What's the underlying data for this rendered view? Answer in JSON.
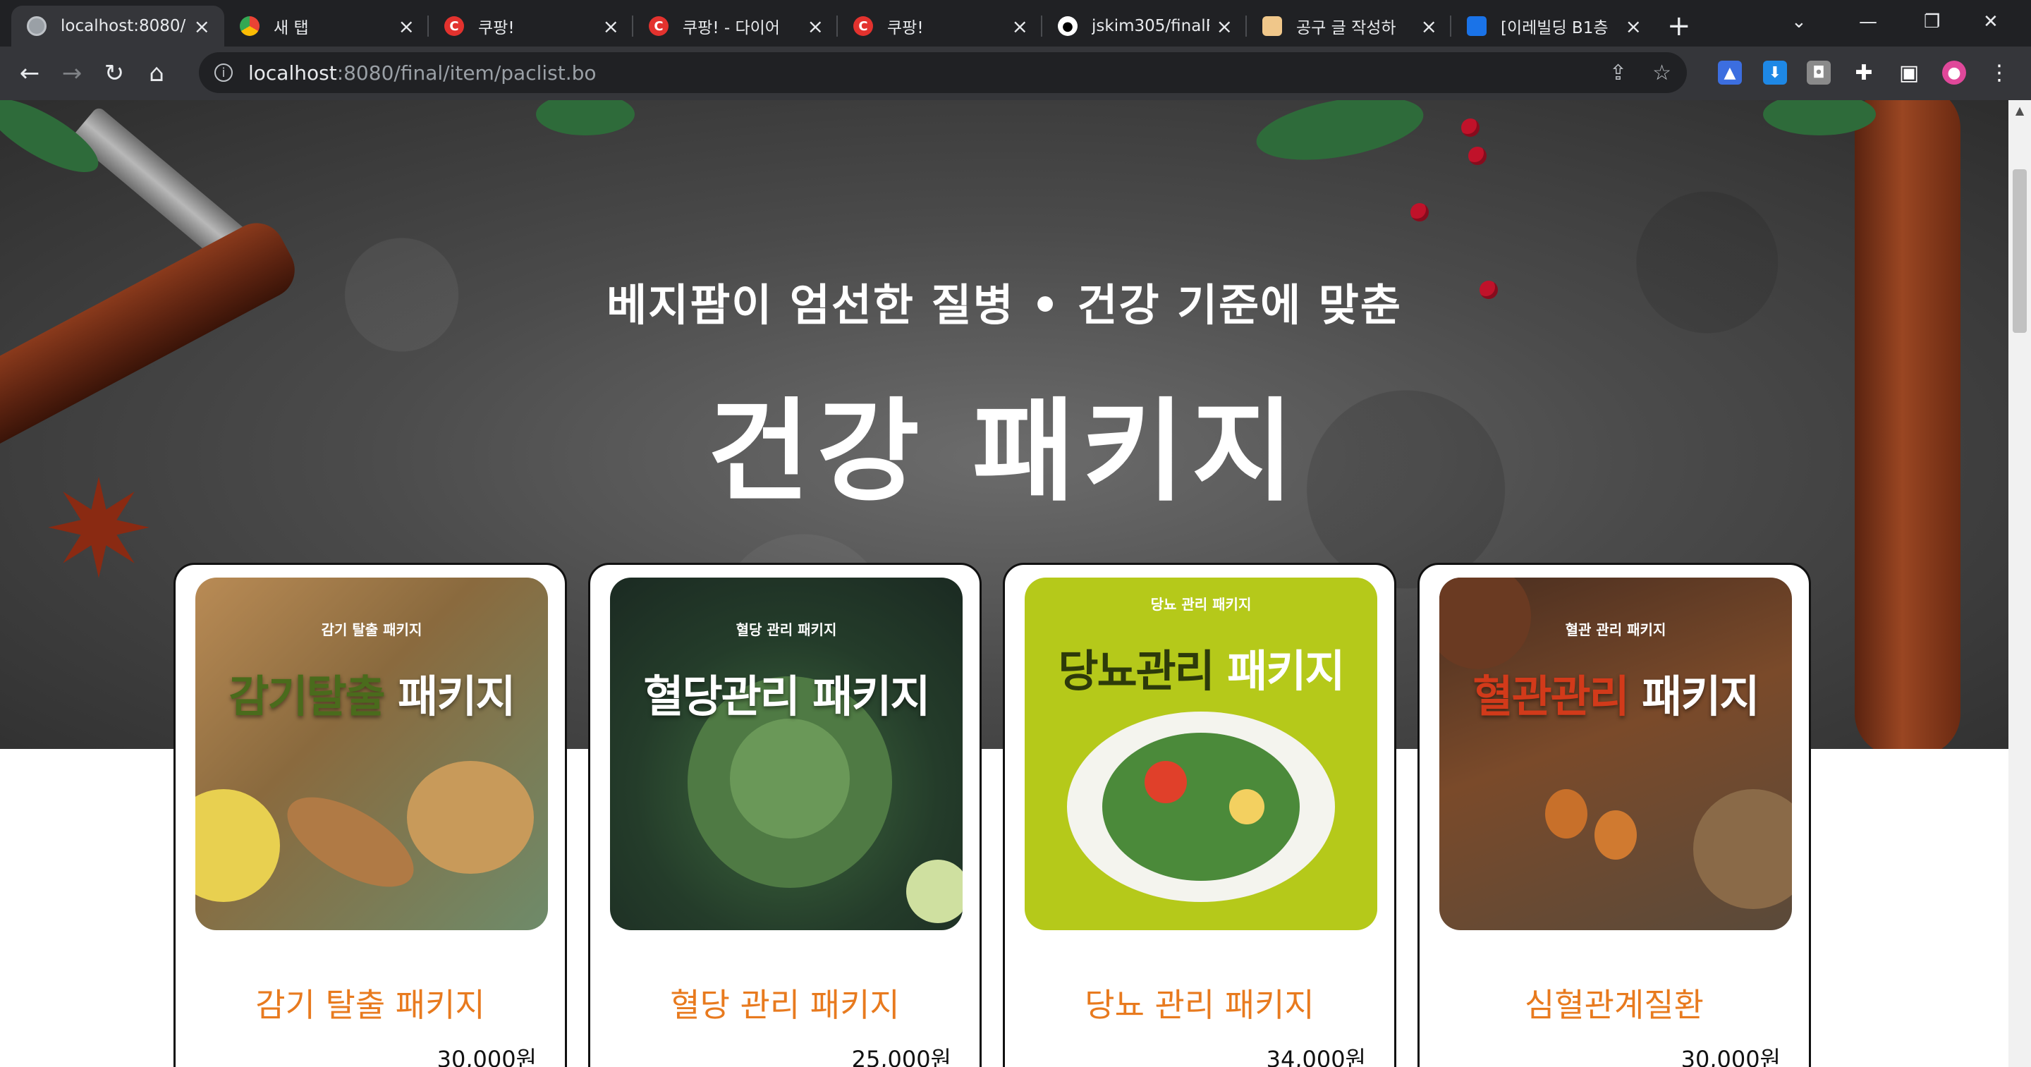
{
  "browser": {
    "tabs": [
      {
        "title": "localhost:8080/",
        "favicon": "globe-icon",
        "active": true
      },
      {
        "title": "새 탭",
        "favicon": "chrome-icon",
        "active": false
      },
      {
        "title": "쿠팡!",
        "favicon": "coupang-icon",
        "active": false
      },
      {
        "title": "쿠팡! - 다이어",
        "favicon": "coupang-icon",
        "active": false
      },
      {
        "title": "쿠팡!",
        "favicon": "coupang-icon",
        "active": false
      },
      {
        "title": "jskim305/finalP",
        "favicon": "github-icon",
        "active": false
      },
      {
        "title": "공구 글 작성하",
        "favicon": "folder-icon",
        "active": false
      },
      {
        "title": "[이레빌딩 B1층",
        "favicon": "blue-app-icon",
        "active": false
      }
    ],
    "new_tab_symbol": "+",
    "url_host": "localhost",
    "url_path": ":8080/final/item/paclist.bo"
  },
  "hero": {
    "subtitle": "베지팜이 엄선한 질병 • 건강 기준에 맞춘",
    "title": "건강 패키지"
  },
  "products": [
    {
      "thumb_small": "감기 탈출 패키지",
      "thumb_big_accent": "감기탈출",
      "thumb_big_rest": " 패키지",
      "name": "감기 탈출 패키지",
      "price": "30,000원",
      "accent_color": "#4a6b1c"
    },
    {
      "thumb_small": "혈당 관리 패키지",
      "thumb_big_accent": "혈당관리",
      "thumb_big_rest": " 패키지",
      "name": "혈당 관리 패키지",
      "price": "25,000원",
      "accent_color": "#ffffff"
    },
    {
      "thumb_small": "당뇨 관리 패키지",
      "thumb_big_accent": "당뇨관리",
      "thumb_big_rest": " 패키지",
      "name": "당뇨 관리 패키지",
      "price": "34,000원",
      "accent_color": "#2d3a0a"
    },
    {
      "thumb_small": "혈관 관리 패키지",
      "thumb_big_accent": "혈관관리",
      "thumb_big_rest": " 패키지",
      "name": "심혈관계질환",
      "price": "30,000원",
      "accent_color": "#d23a1a"
    }
  ],
  "colors": {
    "product_name": "#e87a1e",
    "browser_dark": "#202124",
    "browser_toolbar": "#35363a"
  }
}
